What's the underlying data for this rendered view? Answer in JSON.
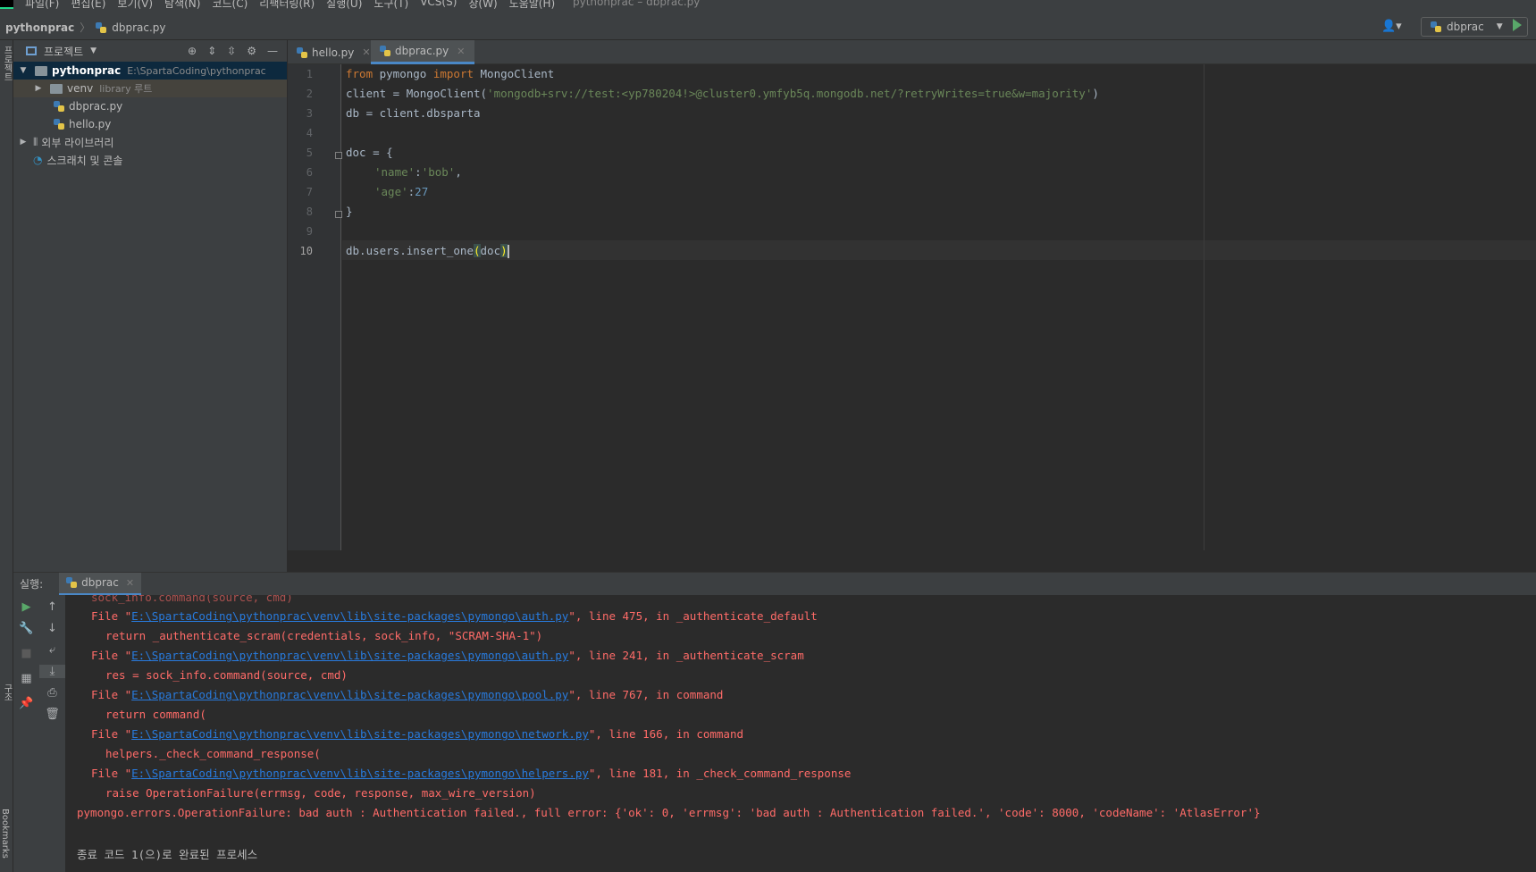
{
  "menubar": {
    "items": [
      "파일(F)",
      "편집(E)",
      "보기(V)",
      "탐색(N)",
      "코드(C)",
      "리팩터링(R)",
      "실행(U)",
      "도구(T)",
      "VCS(S)",
      "창(W)",
      "도움말(H)"
    ],
    "window_title": "pythonprac – dbprac.py"
  },
  "navbar": {
    "project": "pythonprac",
    "file": "dbprac.py",
    "run_config": "dbprac"
  },
  "left_strip": {
    "project_label": "프로젝트",
    "structure_label": "구조",
    "bookmarks_label": "Bookmarks"
  },
  "project_panel": {
    "title": "프로젝트",
    "tree": [
      {
        "label": "pythonprac",
        "hint": "E:\\SpartaCoding\\pythonprac"
      },
      {
        "label": "venv",
        "hint": "library 루트"
      },
      {
        "label": "dbprac.py"
      },
      {
        "label": "hello.py"
      },
      {
        "label": "외부 라이브러리"
      },
      {
        "label": "스크래치 및 콘솔"
      }
    ]
  },
  "tabs": [
    {
      "label": "hello.py"
    },
    {
      "label": "dbprac.py"
    }
  ],
  "editor": {
    "line_numbers": [
      "1",
      "2",
      "3",
      "4",
      "5",
      "6",
      "7",
      "8",
      "9",
      "10"
    ],
    "code": {
      "l1_kw1": "from",
      "l1_mid": " pymongo ",
      "l1_kw2": "import",
      "l1_end": " MongoClient",
      "l2_start": "client = MongoClient(",
      "l2_str": "'mongodb+srv://test:<yp780204!>@cluster0.ymfyb5q.mongodb.net/?retryWrites=true&w=majority'",
      "l2_end": ")",
      "l3": "db = client.dbsparta",
      "l5": "doc = {",
      "l6_key": "'name'",
      "l6_colon": ":",
      "l6_val": "'bob'",
      "l6_comma": ",",
      "l7_key": "'age'",
      "l7_colon": ":",
      "l7_val": "27",
      "l8": "}",
      "l10_start": "db.users.insert_one",
      "l10_open": "(",
      "l10_arg": "doc",
      "l10_close": ")"
    }
  },
  "run_window": {
    "label": "실행:",
    "tab": "dbprac",
    "console": {
      "l1_pre": "File \"",
      "l1_link": "E:\\SpartaCoding\\pythonprac\\venv\\lib\\site-packages\\pymongo\\auth.py",
      "l1_post": "\", line 475, in _authenticate_default",
      "l2": "return _authenticate_scram(credentials, sock_info, \"SCRAM-SHA-1\")",
      "l3_pre": "File \"",
      "l3_link": "E:\\SpartaCoding\\pythonprac\\venv\\lib\\site-packages\\pymongo\\auth.py",
      "l3_post": "\", line 241, in _authenticate_scram",
      "l4": "res = sock_info.command(source, cmd)",
      "l5_pre": "File \"",
      "l5_link": "E:\\SpartaCoding\\pythonprac\\venv\\lib\\site-packages\\pymongo\\pool.py",
      "l5_post": "\", line 767, in command",
      "l6": "return command(",
      "l7_pre": "File \"",
      "l7_link": "E:\\SpartaCoding\\pythonprac\\venv\\lib\\site-packages\\pymongo\\network.py",
      "l7_post": "\", line 166, in command",
      "l8": "helpers._check_command_response(",
      "l9_pre": "File \"",
      "l9_link": "E:\\SpartaCoding\\pythonprac\\venv\\lib\\site-packages\\pymongo\\helpers.py",
      "l9_post": "\", line 181, in _check_command_response",
      "l10": "raise OperationFailure(errmsg, code, response, max_wire_version)",
      "l11": "pymongo.errors.OperationFailure: bad auth : Authentication failed., full error: {'ok': 0, 'errmsg': 'bad auth : Authentication failed.', 'code': 8000, 'codeName': 'AtlasError'}",
      "l13": "종료 코드 1(으)로 완료된 프로세스"
    }
  },
  "colors": {
    "background": "#2b2b2b",
    "panel": "#3c3f41",
    "keyword": "#cc7832",
    "string": "#6a8759",
    "number": "#6897bb",
    "error": "#ff6b68",
    "link": "#287bde",
    "accent": "#4a88c7"
  }
}
